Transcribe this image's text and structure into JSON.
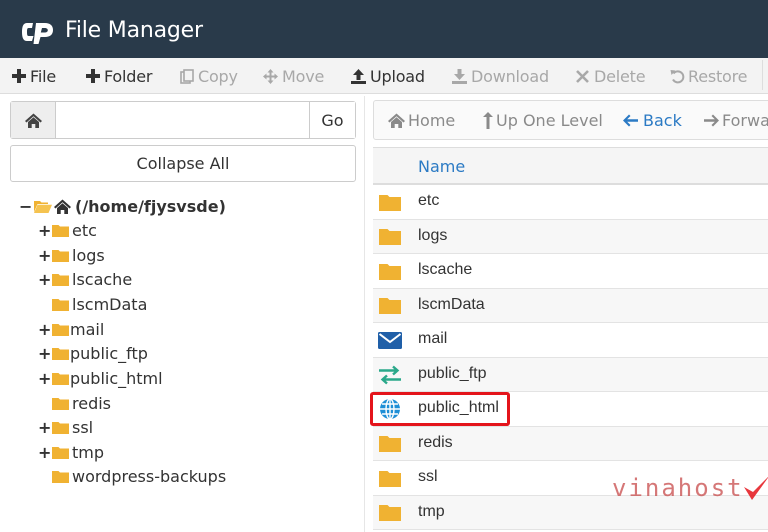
{
  "header": {
    "title": "File Manager",
    "logo_text": "cP"
  },
  "toolbar": {
    "items": [
      {
        "label": "File",
        "icon": "plus-icon",
        "enabled": true
      },
      {
        "label": "Folder",
        "icon": "plus-icon",
        "enabled": true
      },
      {
        "label": "Copy",
        "icon": "copy-icon",
        "enabled": false
      },
      {
        "label": "Move",
        "icon": "move-icon",
        "enabled": false
      },
      {
        "label": "Upload",
        "icon": "upload-icon",
        "enabled": true
      },
      {
        "label": "Download",
        "icon": "download-icon",
        "enabled": false
      },
      {
        "label": "Delete",
        "icon": "close-icon",
        "enabled": false
      },
      {
        "label": "Restore",
        "icon": "undo-icon",
        "enabled": false
      }
    ]
  },
  "search": {
    "value": "",
    "go_label": "Go"
  },
  "tree": {
    "collapse_label": "Collapse All",
    "root": {
      "label": "(/home/fjysvsde)",
      "toggle": "−"
    },
    "items": [
      {
        "label": "etc",
        "toggle": "+"
      },
      {
        "label": "logs",
        "toggle": "+"
      },
      {
        "label": "lscache",
        "toggle": "+"
      },
      {
        "label": "lscmData",
        "toggle": ""
      },
      {
        "label": "mail",
        "toggle": "+"
      },
      {
        "label": "public_ftp",
        "toggle": "+"
      },
      {
        "label": "public_html",
        "toggle": "+"
      },
      {
        "label": "redis",
        "toggle": ""
      },
      {
        "label": "ssl",
        "toggle": "+"
      },
      {
        "label": "tmp",
        "toggle": "+"
      },
      {
        "label": "wordpress-backups",
        "toggle": ""
      }
    ]
  },
  "nav": {
    "home": "Home",
    "up": "Up One Level",
    "back": "Back",
    "forward": "Forwar"
  },
  "files": {
    "column_name": "Name",
    "rows": [
      {
        "name": "etc",
        "icon": "folder-icon"
      },
      {
        "name": "logs",
        "icon": "folder-icon"
      },
      {
        "name": "lscache",
        "icon": "folder-icon"
      },
      {
        "name": "lscmData",
        "icon": "folder-icon"
      },
      {
        "name": "mail",
        "icon": "envelope-icon"
      },
      {
        "name": "public_ftp",
        "icon": "transfer-arrows-icon"
      },
      {
        "name": "public_html",
        "icon": "globe-icon"
      },
      {
        "name": "redis",
        "icon": "folder-icon"
      },
      {
        "name": "ssl",
        "icon": "folder-icon"
      },
      {
        "name": "tmp",
        "icon": "folder-icon"
      }
    ],
    "highlighted": "public_html"
  },
  "watermark": {
    "text": "vinahost"
  },
  "colors": {
    "header_bg": "#293a4a",
    "folder": "#f0b232",
    "link": "#2b7ac4",
    "highlight": "#e4141b",
    "mail": "#1f5fa8",
    "ftp": "#2aa88a",
    "globe": "#1e8fd6"
  }
}
